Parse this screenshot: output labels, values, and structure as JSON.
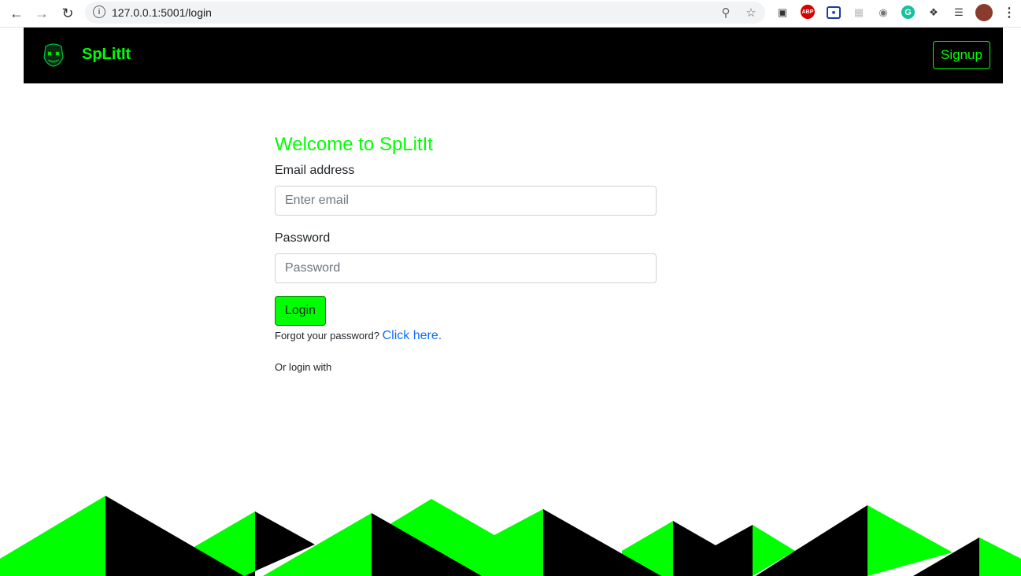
{
  "browser": {
    "url": "127.0.0.1:5001/login"
  },
  "navbar": {
    "brand": "SpLitIt",
    "signup_label": "Signup"
  },
  "login_form": {
    "title": "Welcome to SpLitIt",
    "email_label": "Email address",
    "email_placeholder": "Enter email",
    "password_label": "Password",
    "password_placeholder": "Password",
    "login_label": "Login",
    "forgot_text": "Forgot your password?",
    "forgot_link": "Click here.",
    "or_login_text": "Or login with"
  },
  "colors": {
    "accent": "#00ff00",
    "navbar_bg": "#000000",
    "link": "#0d6efd"
  },
  "icons": [
    "back-arrow-icon",
    "forward-arrow-icon",
    "reload-icon",
    "info-icon",
    "key-icon",
    "star-icon",
    "extensions-icon",
    "menu-icon"
  ]
}
